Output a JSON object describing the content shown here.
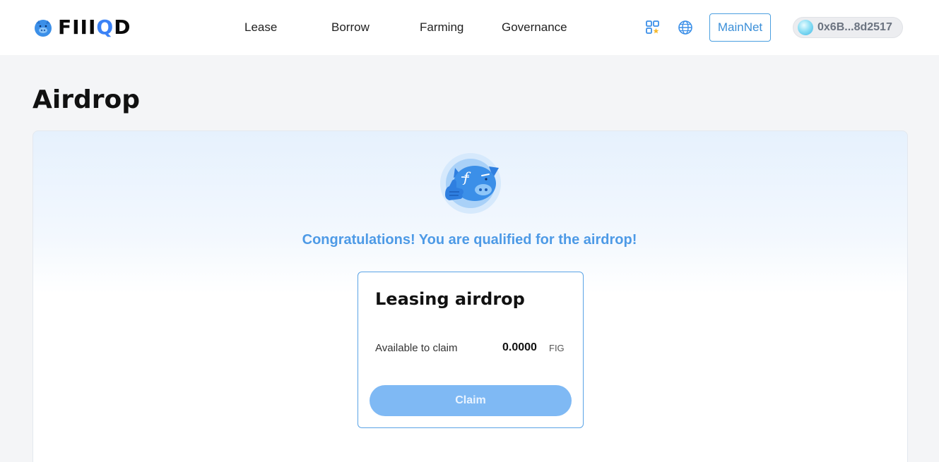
{
  "header": {
    "logo_text_prefix": "FIII",
    "logo_text_q": "Q",
    "logo_text_suffix": "D",
    "logo_icon": "pig-logo-icon",
    "nav": [
      {
        "label": "Lease"
      },
      {
        "label": "Borrow"
      },
      {
        "label": "Farming"
      },
      {
        "label": "Governance"
      }
    ],
    "apps_icon": "apps-grid-icon",
    "language_icon": "globe-icon",
    "network_label": "MainNet",
    "wallet_address": "0x6B...8d2517"
  },
  "page": {
    "title": "Airdrop",
    "mascot_icon": "pig-mascot-thumbs-up-icon",
    "congrats_text": "Congratulations! You are qualified for the airdrop!"
  },
  "card": {
    "title": "Leasing airdrop",
    "available_label": "Available to claim",
    "available_value": "0.0000",
    "unit": "FIG",
    "claim_label": "Claim"
  },
  "colors": {
    "accent": "#4d9ae6",
    "claim_button": "#7fb9f4",
    "network_border": "#4a9fe0",
    "page_bg": "#f4f5f7"
  }
}
